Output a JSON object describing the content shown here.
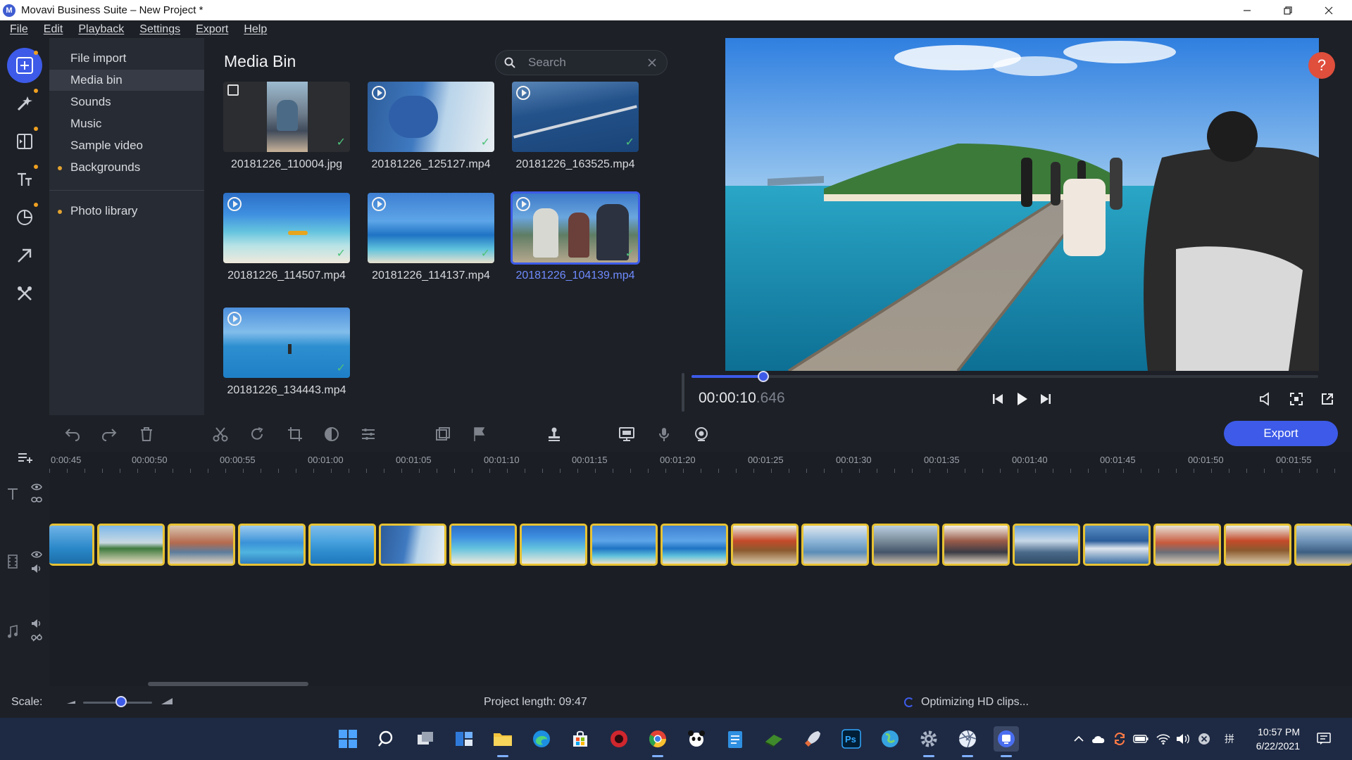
{
  "window": {
    "title": "Movavi Business Suite – New Project *",
    "app_icon_glyph": "M"
  },
  "menu": [
    "File",
    "Edit",
    "Playback",
    "Settings",
    "Export",
    "Help"
  ],
  "rail": [
    {
      "name": "import-icon",
      "active": true,
      "dot": true
    },
    {
      "name": "magic-wand-icon",
      "active": false,
      "dot": true
    },
    {
      "name": "transitions-icon",
      "active": false,
      "dot": true
    },
    {
      "name": "titles-icon",
      "active": false,
      "dot": true
    },
    {
      "name": "stickers-icon",
      "active": false,
      "dot": true
    },
    {
      "name": "callouts-icon",
      "active": false,
      "dot": false
    },
    {
      "name": "tools-icon",
      "active": false,
      "dot": false
    }
  ],
  "categories": [
    {
      "label": "File import",
      "bullet": false,
      "active": false
    },
    {
      "label": "Media bin",
      "bullet": false,
      "active": true
    },
    {
      "label": "Sounds",
      "bullet": false,
      "active": false
    },
    {
      "label": "Music",
      "bullet": false,
      "active": false
    },
    {
      "label": "Sample video",
      "bullet": false,
      "active": false
    },
    {
      "label": "Backgrounds",
      "bullet": true,
      "active": false
    },
    {
      "label": "Photo library",
      "bullet": true,
      "active": false
    }
  ],
  "media_bin": {
    "title": "Media Bin",
    "search_placeholder": "Search",
    "items": [
      {
        "label": "20181226_110004.jpg",
        "type": "image",
        "checked": true,
        "selected": false
      },
      {
        "label": "20181226_125127.mp4",
        "type": "video",
        "checked": true,
        "selected": false
      },
      {
        "label": "20181226_163525.mp4",
        "type": "video",
        "checked": true,
        "selected": false
      },
      {
        "label": "20181226_114507.mp4",
        "type": "video",
        "checked": true,
        "selected": false
      },
      {
        "label": "20181226_114137.mp4",
        "type": "video",
        "checked": true,
        "selected": false
      },
      {
        "label": "20181226_104139.mp4",
        "type": "video",
        "checked": true,
        "selected": true
      },
      {
        "label": "20181226_134443.mp4",
        "type": "video",
        "checked": true,
        "selected": false
      }
    ]
  },
  "preview": {
    "timecode_main": "00:00:10",
    "timecode_ms": ".646",
    "progress": 0.115,
    "help_glyph": "?"
  },
  "toolbar": {
    "export_label": "Export"
  },
  "timeline": {
    "ticks": [
      "0:00:45",
      "00:00:50",
      "00:00:55",
      "00:01:00",
      "00:01:05",
      "00:01:10",
      "00:01:15",
      "00:01:20",
      "00:01:25",
      "00:01:30",
      "00:01:35",
      "00:01:40",
      "00:01:45",
      "00:01:50",
      "00:01:55"
    ]
  },
  "status": {
    "scale_label": "Scale:",
    "project_length": "Project length: 09:47",
    "optimizing": "Optimizing HD clips...",
    "scale_value": 0.55
  },
  "taskbar": {
    "time": "10:57 PM",
    "date": "6/22/2021",
    "tray_lang_glyph": "拼"
  },
  "colors": {
    "accent": "#3d5be8",
    "clip_border": "#e7c234",
    "help": "#e04e3c",
    "check": "#4fc27a"
  }
}
